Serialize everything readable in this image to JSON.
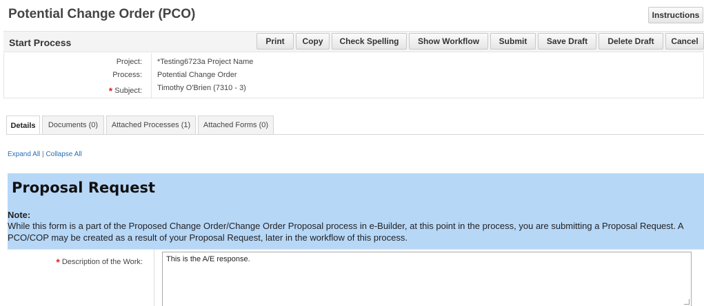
{
  "header": {
    "title": "Potential Change Order (PCO)",
    "instructions_label": "Instructions"
  },
  "toolbar": {
    "section_title": "Start Process",
    "print_label": "Print",
    "copy_label": "Copy",
    "check_spelling_label": "Check Spelling",
    "show_workflow_label": "Show Workflow",
    "submit_label": "Submit",
    "save_draft_label": "Save Draft",
    "delete_draft_label": "Delete Draft",
    "cancel_label": "Cancel"
  },
  "info": {
    "project_label": "Project:",
    "project_value": "*Testing6723a Project Name",
    "process_label": "Process:",
    "process_value": "Potential Change Order",
    "subject_label": "Subject:",
    "subject_value": "Timothy O'Brien (7310 - 3)"
  },
  "tabs": [
    {
      "label": "Details",
      "active": true
    },
    {
      "label": "Documents (0)",
      "active": false
    },
    {
      "label": "Attached Processes (1)",
      "active": false
    },
    {
      "label": "Attached Forms (0)",
      "active": false
    }
  ],
  "links": {
    "expand_all": "Expand All",
    "separator": "|",
    "collapse_all": "Collapse All"
  },
  "section": {
    "title": "Proposal Request",
    "note_label": "Note:",
    "note_text": "While this form is a part of the Proposed Change Order/Change Order Proposal process in e-Builder, at this point in the process, you are submitting a Proposal Request. A PCO/COP may be created as a result of your Proposal Request, later in the workflow of this process."
  },
  "form": {
    "description_label": "Description of the Work:",
    "description_value": "This is the A/E response."
  },
  "colors": {
    "section_header_bg": "#b7d7f7",
    "link": "#2a6db4",
    "required": "#dd2222"
  }
}
